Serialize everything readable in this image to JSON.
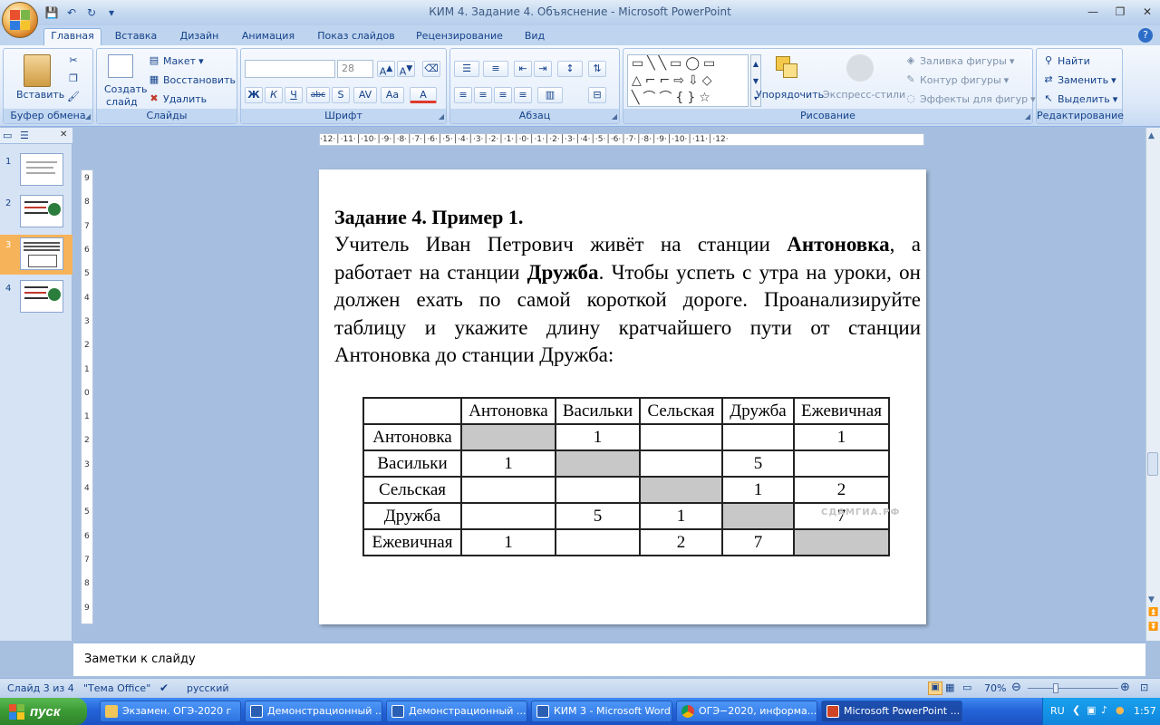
{
  "window": {
    "title": "КИМ 4. Задание 4. Объяснение - Microsoft PowerPoint"
  },
  "ribbon_tabs": [
    "Главная",
    "Вставка",
    "Дизайн",
    "Анимация",
    "Показ слайдов",
    "Рецензирование",
    "Вид"
  ],
  "ribbon": {
    "clipboard": {
      "label": "Буфер обмена",
      "paste": "Вставить"
    },
    "slides": {
      "label": "Слайды",
      "new_slide_1": "Создать",
      "new_slide_2": "слайд",
      "layout": "Макет",
      "reset": "Восстановить",
      "delete": "Удалить"
    },
    "font": {
      "label": "Шрифт",
      "size": "28",
      "bold": "Ж",
      "italic": "К",
      "underline": "Ч",
      "strike": "abc",
      "shadow": "S"
    },
    "paragraph": {
      "label": "Абзац"
    },
    "drawing": {
      "label": "Рисование",
      "arrange": "Упорядочить",
      "quick_styles": "Экспресс-стили",
      "fill": "Заливка фигуры",
      "outline": "Контур фигуры",
      "effects": "Эффекты для фигур"
    },
    "editing": {
      "label": "Редактирование",
      "find": "Найти",
      "replace": "Заменить",
      "select": "Выделить"
    }
  },
  "slide_thumbnails": [
    {
      "num": "1",
      "selected": false
    },
    {
      "num": "2",
      "selected": false
    },
    {
      "num": "3",
      "selected": true
    },
    {
      "num": "4",
      "selected": false
    }
  ],
  "ruler": {
    "horizontal": "·12·│·11·│·10·│·9·│·8·│·7·│·6·│·5·│·4·│·3·│·2·│·1·│·0·│·1·│·2·│·3·│·4·│·5·│·6·│·7·│·8·│·9·│·10·│·11·│·12·",
    "vertical": [
      "9",
      "8",
      "7",
      "6",
      "5",
      "4",
      "3",
      "2",
      "1",
      "0",
      "1",
      "2",
      "3",
      "4",
      "5",
      "6",
      "7",
      "8",
      "9"
    ]
  },
  "slide": {
    "title": "Задание 4. Пример 1.",
    "body_1": "Учитель Иван Петрович живёт на станции ",
    "body_bold_1": "Антоновка",
    "body_2": ", а работает на станции ",
    "body_bold_2": "Дружба",
    "body_3": ". Чтобы успеть с утра на уроки, он должен ехать по самой короткой дороге. Проанализируйте таблицу и укажите длину кратчайшего пути от станции Антоновка до станции Дружба:",
    "table": {
      "headers": [
        "",
        "Антоновка",
        "Васильки",
        "Сельская",
        "Дружба",
        "Ежевичная"
      ],
      "rows": [
        [
          "Антоновка",
          "",
          "1",
          "",
          "",
          "1"
        ],
        [
          "Васильки",
          "1",
          "",
          "",
          "5",
          ""
        ],
        [
          "Сельская",
          "",
          "",
          "",
          "1",
          "2"
        ],
        [
          "Дружба",
          "",
          "5",
          "1",
          "",
          "7"
        ],
        [
          "Ежевичная",
          "1",
          "",
          "2",
          "7",
          ""
        ]
      ]
    },
    "watermark": "СДАМГИА.РФ"
  },
  "notes": {
    "placeholder": "Заметки к слайду"
  },
  "status": {
    "slide_of": "Слайд 3 из 4",
    "theme": "\"Тема Office\"",
    "language": "русский",
    "zoom": "70%"
  },
  "taskbar": {
    "start": "пуск",
    "tasks": [
      {
        "label": "Экзамен. ОГЭ-2020 г",
        "active": false
      },
      {
        "label": "Демонстрационный ...",
        "active": false
      },
      {
        "label": "Демонстрационный ...",
        "active": false
      },
      {
        "label": "КИМ 3 - Microsoft Word",
        "active": false
      },
      {
        "label": "ОГЭ−2020, информа...",
        "active": false
      },
      {
        "label": "Microsoft PowerPoint ...",
        "active": true
      }
    ],
    "lang": "RU",
    "clock": "1:57"
  },
  "colors": {
    "accent": "#15428b",
    "slide_bg": "#ffffff",
    "taskbar": "#2463d8",
    "selected_thumb": "#f7b35a",
    "table_gray": "#c8c8c8"
  }
}
